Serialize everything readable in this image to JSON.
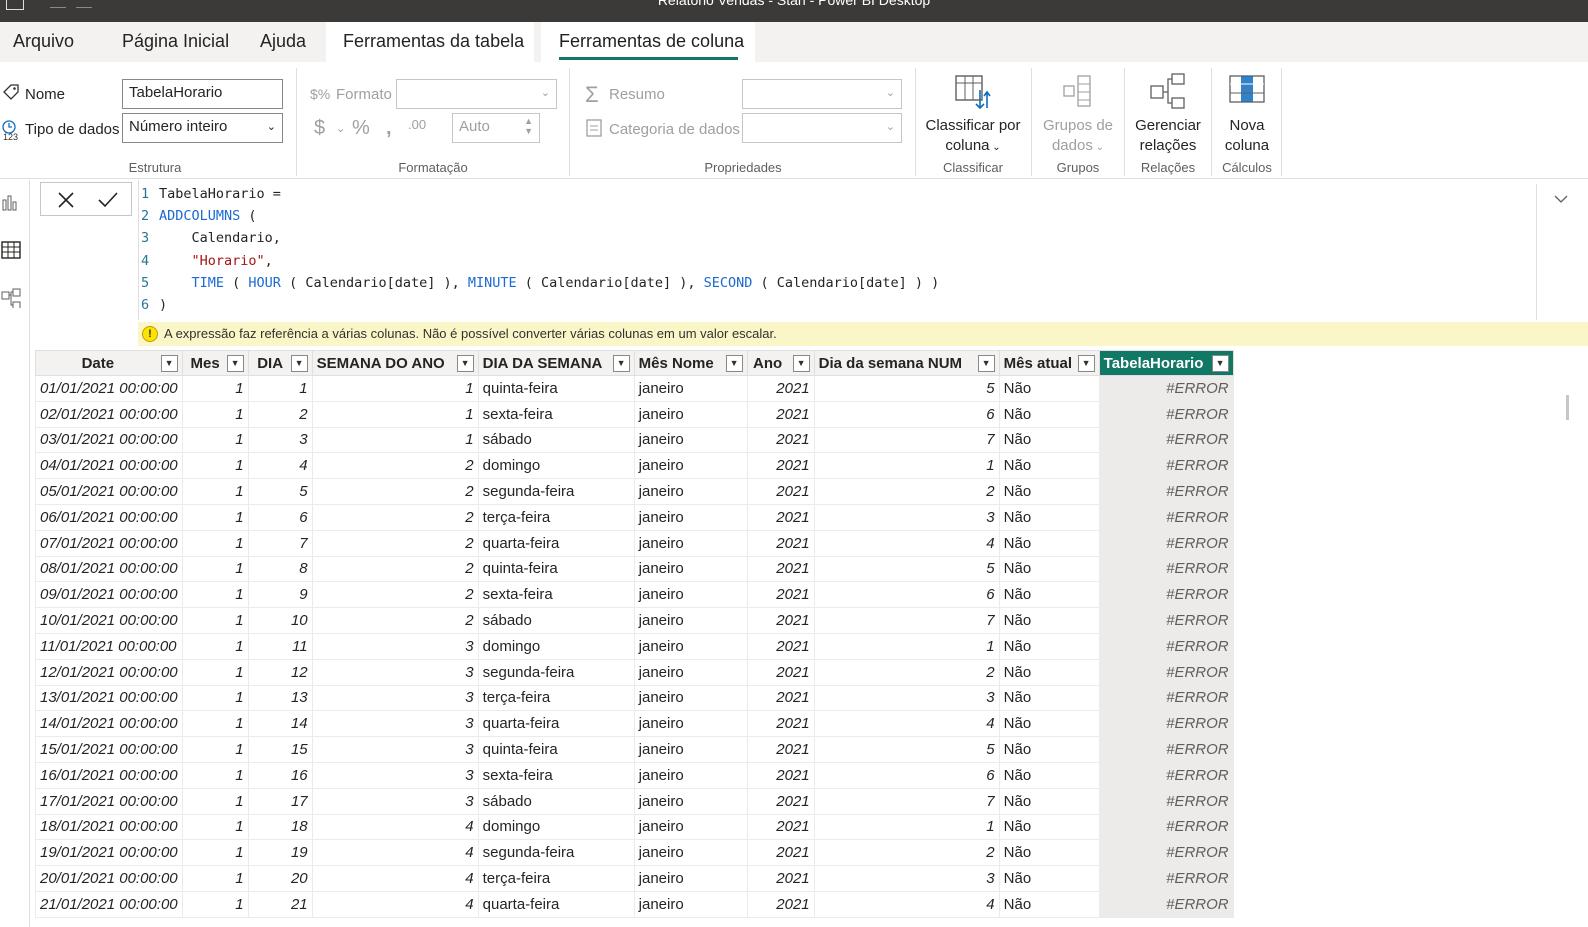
{
  "window": {
    "title": "Relatorio Vendas - Stan - Power BI Desktop"
  },
  "tabs": [
    {
      "label": "Arquivo"
    },
    {
      "label": "Página Inicial"
    },
    {
      "label": "Ajuda"
    },
    {
      "label": "Ferramentas da tabela"
    },
    {
      "label": "Ferramentas de coluna"
    }
  ],
  "ribbon": {
    "estrutura": {
      "nome_label": "Nome",
      "nome_value": "TabelaHorario",
      "tipo_label": "Tipo de dados",
      "tipo_value": "Número inteiro",
      "group_label": "Estrutura"
    },
    "formatacao": {
      "formato_label": "Formato",
      "formato_value": "",
      "auto_value": "Auto",
      "group_label": "Formatação"
    },
    "propriedades": {
      "resumo_label": "Resumo",
      "categoria_label": "Categoria de dados",
      "group_label": "Propriedades"
    },
    "classificar": {
      "button_line1": "Classificar por",
      "button_line2": "coluna",
      "group_label": "Classificar"
    },
    "grupos": {
      "button_line1": "Grupos de",
      "button_line2": "dados",
      "group_label": "Grupos"
    },
    "relacoes": {
      "button_line1": "Gerenciar",
      "button_line2": "relações",
      "group_label": "Relações"
    },
    "calculos": {
      "button_line1": "Nova",
      "button_line2": "coluna",
      "group_label": "Cálculos"
    }
  },
  "formula": {
    "lines": [
      {
        "num": "1",
        "text": "TabelaHorario ="
      },
      {
        "num": "2",
        "text": "ADDCOLUMNS ("
      },
      {
        "num": "3",
        "text": "    Calendario,"
      },
      {
        "num": "4",
        "text": "    \"Horario\","
      },
      {
        "num": "5",
        "text": "    TIME ( HOUR ( Calendario[date] ), MINUTE ( Calendario[date] ), SECOND ( Calendario[date] ) )"
      },
      {
        "num": "6",
        "text": ")"
      }
    ],
    "warning": "A expressão faz referência a várias colunas. Não é possível converter várias colunas em um valor escalar."
  },
  "table": {
    "columns": [
      "Date",
      "Mes",
      "DIA",
      "SEMANA DO ANO",
      "DIA DA SEMANA",
      "Mês Nome",
      "Ano",
      "Dia da semana NUM",
      "Mês atual",
      "TabelaHorario"
    ],
    "rows": [
      [
        "01/01/2021 00:00:00",
        "1",
        "1",
        "1",
        "quinta-feira",
        "janeiro",
        "2021",
        "5",
        "Não",
        "#ERROR"
      ],
      [
        "02/01/2021 00:00:00",
        "1",
        "2",
        "1",
        "sexta-feira",
        "janeiro",
        "2021",
        "6",
        "Não",
        "#ERROR"
      ],
      [
        "03/01/2021 00:00:00",
        "1",
        "3",
        "1",
        "sábado",
        "janeiro",
        "2021",
        "7",
        "Não",
        "#ERROR"
      ],
      [
        "04/01/2021 00:00:00",
        "1",
        "4",
        "2",
        "domingo",
        "janeiro",
        "2021",
        "1",
        "Não",
        "#ERROR"
      ],
      [
        "05/01/2021 00:00:00",
        "1",
        "5",
        "2",
        "segunda-feira",
        "janeiro",
        "2021",
        "2",
        "Não",
        "#ERROR"
      ],
      [
        "06/01/2021 00:00:00",
        "1",
        "6",
        "2",
        "terça-feira",
        "janeiro",
        "2021",
        "3",
        "Não",
        "#ERROR"
      ],
      [
        "07/01/2021 00:00:00",
        "1",
        "7",
        "2",
        "quarta-feira",
        "janeiro",
        "2021",
        "4",
        "Não",
        "#ERROR"
      ],
      [
        "08/01/2021 00:00:00",
        "1",
        "8",
        "2",
        "quinta-feira",
        "janeiro",
        "2021",
        "5",
        "Não",
        "#ERROR"
      ],
      [
        "09/01/2021 00:00:00",
        "1",
        "9",
        "2",
        "sexta-feira",
        "janeiro",
        "2021",
        "6",
        "Não",
        "#ERROR"
      ],
      [
        "10/01/2021 00:00:00",
        "1",
        "10",
        "2",
        "sábado",
        "janeiro",
        "2021",
        "7",
        "Não",
        "#ERROR"
      ],
      [
        "11/01/2021 00:00:00",
        "1",
        "11",
        "3",
        "domingo",
        "janeiro",
        "2021",
        "1",
        "Não",
        "#ERROR"
      ],
      [
        "12/01/2021 00:00:00",
        "1",
        "12",
        "3",
        "segunda-feira",
        "janeiro",
        "2021",
        "2",
        "Não",
        "#ERROR"
      ],
      [
        "13/01/2021 00:00:00",
        "1",
        "13",
        "3",
        "terça-feira",
        "janeiro",
        "2021",
        "3",
        "Não",
        "#ERROR"
      ],
      [
        "14/01/2021 00:00:00",
        "1",
        "14",
        "3",
        "quarta-feira",
        "janeiro",
        "2021",
        "4",
        "Não",
        "#ERROR"
      ],
      [
        "15/01/2021 00:00:00",
        "1",
        "15",
        "3",
        "quinta-feira",
        "janeiro",
        "2021",
        "5",
        "Não",
        "#ERROR"
      ],
      [
        "16/01/2021 00:00:00",
        "1",
        "16",
        "3",
        "sexta-feira",
        "janeiro",
        "2021",
        "6",
        "Não",
        "#ERROR"
      ],
      [
        "17/01/2021 00:00:00",
        "1",
        "17",
        "3",
        "sábado",
        "janeiro",
        "2021",
        "7",
        "Não",
        "#ERROR"
      ],
      [
        "18/01/2021 00:00:00",
        "1",
        "18",
        "4",
        "domingo",
        "janeiro",
        "2021",
        "1",
        "Não",
        "#ERROR"
      ],
      [
        "19/01/2021 00:00:00",
        "1",
        "19",
        "4",
        "segunda-feira",
        "janeiro",
        "2021",
        "2",
        "Não",
        "#ERROR"
      ],
      [
        "20/01/2021 00:00:00",
        "1",
        "20",
        "4",
        "terça-feira",
        "janeiro",
        "2021",
        "3",
        "Não",
        "#ERROR"
      ],
      [
        "21/01/2021 00:00:00",
        "1",
        "21",
        "4",
        "quarta-feira",
        "janeiro",
        "2021",
        "4",
        "Não",
        "#ERROR"
      ]
    ]
  },
  "colors": {
    "accent": "#117865",
    "warning_bg": "#fbf6c8",
    "code_keyword": "#1a6ad2",
    "code_string": "#a31515"
  }
}
